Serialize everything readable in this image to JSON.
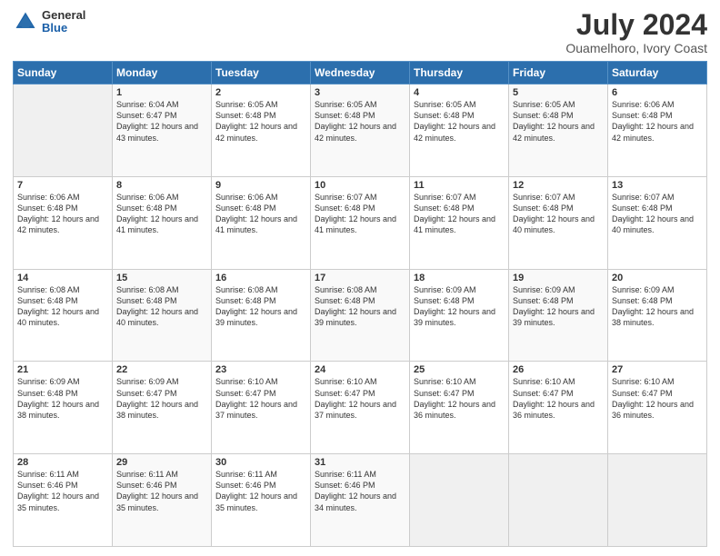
{
  "header": {
    "logo_general": "General",
    "logo_blue": "Blue",
    "title": "July 2024",
    "subtitle": "Ouamelhoro, Ivory Coast"
  },
  "days_of_week": [
    "Sunday",
    "Monday",
    "Tuesday",
    "Wednesday",
    "Thursday",
    "Friday",
    "Saturday"
  ],
  "weeks": [
    [
      {
        "day": "",
        "sunrise": "",
        "sunset": "",
        "daylight": ""
      },
      {
        "day": "1",
        "sunrise": "Sunrise: 6:04 AM",
        "sunset": "Sunset: 6:47 PM",
        "daylight": "Daylight: 12 hours and 43 minutes."
      },
      {
        "day": "2",
        "sunrise": "Sunrise: 6:05 AM",
        "sunset": "Sunset: 6:48 PM",
        "daylight": "Daylight: 12 hours and 42 minutes."
      },
      {
        "day": "3",
        "sunrise": "Sunrise: 6:05 AM",
        "sunset": "Sunset: 6:48 PM",
        "daylight": "Daylight: 12 hours and 42 minutes."
      },
      {
        "day": "4",
        "sunrise": "Sunrise: 6:05 AM",
        "sunset": "Sunset: 6:48 PM",
        "daylight": "Daylight: 12 hours and 42 minutes."
      },
      {
        "day": "5",
        "sunrise": "Sunrise: 6:05 AM",
        "sunset": "Sunset: 6:48 PM",
        "daylight": "Daylight: 12 hours and 42 minutes."
      },
      {
        "day": "6",
        "sunrise": "Sunrise: 6:06 AM",
        "sunset": "Sunset: 6:48 PM",
        "daylight": "Daylight: 12 hours and 42 minutes."
      }
    ],
    [
      {
        "day": "7",
        "sunrise": "Sunrise: 6:06 AM",
        "sunset": "Sunset: 6:48 PM",
        "daylight": "Daylight: 12 hours and 42 minutes."
      },
      {
        "day": "8",
        "sunrise": "Sunrise: 6:06 AM",
        "sunset": "Sunset: 6:48 PM",
        "daylight": "Daylight: 12 hours and 41 minutes."
      },
      {
        "day": "9",
        "sunrise": "Sunrise: 6:06 AM",
        "sunset": "Sunset: 6:48 PM",
        "daylight": "Daylight: 12 hours and 41 minutes."
      },
      {
        "day": "10",
        "sunrise": "Sunrise: 6:07 AM",
        "sunset": "Sunset: 6:48 PM",
        "daylight": "Daylight: 12 hours and 41 minutes."
      },
      {
        "day": "11",
        "sunrise": "Sunrise: 6:07 AM",
        "sunset": "Sunset: 6:48 PM",
        "daylight": "Daylight: 12 hours and 41 minutes."
      },
      {
        "day": "12",
        "sunrise": "Sunrise: 6:07 AM",
        "sunset": "Sunset: 6:48 PM",
        "daylight": "Daylight: 12 hours and 40 minutes."
      },
      {
        "day": "13",
        "sunrise": "Sunrise: 6:07 AM",
        "sunset": "Sunset: 6:48 PM",
        "daylight": "Daylight: 12 hours and 40 minutes."
      }
    ],
    [
      {
        "day": "14",
        "sunrise": "Sunrise: 6:08 AM",
        "sunset": "Sunset: 6:48 PM",
        "daylight": "Daylight: 12 hours and 40 minutes."
      },
      {
        "day": "15",
        "sunrise": "Sunrise: 6:08 AM",
        "sunset": "Sunset: 6:48 PM",
        "daylight": "Daylight: 12 hours and 40 minutes."
      },
      {
        "day": "16",
        "sunrise": "Sunrise: 6:08 AM",
        "sunset": "Sunset: 6:48 PM",
        "daylight": "Daylight: 12 hours and 39 minutes."
      },
      {
        "day": "17",
        "sunrise": "Sunrise: 6:08 AM",
        "sunset": "Sunset: 6:48 PM",
        "daylight": "Daylight: 12 hours and 39 minutes."
      },
      {
        "day": "18",
        "sunrise": "Sunrise: 6:09 AM",
        "sunset": "Sunset: 6:48 PM",
        "daylight": "Daylight: 12 hours and 39 minutes."
      },
      {
        "day": "19",
        "sunrise": "Sunrise: 6:09 AM",
        "sunset": "Sunset: 6:48 PM",
        "daylight": "Daylight: 12 hours and 39 minutes."
      },
      {
        "day": "20",
        "sunrise": "Sunrise: 6:09 AM",
        "sunset": "Sunset: 6:48 PM",
        "daylight": "Daylight: 12 hours and 38 minutes."
      }
    ],
    [
      {
        "day": "21",
        "sunrise": "Sunrise: 6:09 AM",
        "sunset": "Sunset: 6:48 PM",
        "daylight": "Daylight: 12 hours and 38 minutes."
      },
      {
        "day": "22",
        "sunrise": "Sunrise: 6:09 AM",
        "sunset": "Sunset: 6:47 PM",
        "daylight": "Daylight: 12 hours and 38 minutes."
      },
      {
        "day": "23",
        "sunrise": "Sunrise: 6:10 AM",
        "sunset": "Sunset: 6:47 PM",
        "daylight": "Daylight: 12 hours and 37 minutes."
      },
      {
        "day": "24",
        "sunrise": "Sunrise: 6:10 AM",
        "sunset": "Sunset: 6:47 PM",
        "daylight": "Daylight: 12 hours and 37 minutes."
      },
      {
        "day": "25",
        "sunrise": "Sunrise: 6:10 AM",
        "sunset": "Sunset: 6:47 PM",
        "daylight": "Daylight: 12 hours and 36 minutes."
      },
      {
        "day": "26",
        "sunrise": "Sunrise: 6:10 AM",
        "sunset": "Sunset: 6:47 PM",
        "daylight": "Daylight: 12 hours and 36 minutes."
      },
      {
        "day": "27",
        "sunrise": "Sunrise: 6:10 AM",
        "sunset": "Sunset: 6:47 PM",
        "daylight": "Daylight: 12 hours and 36 minutes."
      }
    ],
    [
      {
        "day": "28",
        "sunrise": "Sunrise: 6:11 AM",
        "sunset": "Sunset: 6:46 PM",
        "daylight": "Daylight: 12 hours and 35 minutes."
      },
      {
        "day": "29",
        "sunrise": "Sunrise: 6:11 AM",
        "sunset": "Sunset: 6:46 PM",
        "daylight": "Daylight: 12 hours and 35 minutes."
      },
      {
        "day": "30",
        "sunrise": "Sunrise: 6:11 AM",
        "sunset": "Sunset: 6:46 PM",
        "daylight": "Daylight: 12 hours and 35 minutes."
      },
      {
        "day": "31",
        "sunrise": "Sunrise: 6:11 AM",
        "sunset": "Sunset: 6:46 PM",
        "daylight": "Daylight: 12 hours and 34 minutes."
      },
      {
        "day": "",
        "sunrise": "",
        "sunset": "",
        "daylight": ""
      },
      {
        "day": "",
        "sunrise": "",
        "sunset": "",
        "daylight": ""
      },
      {
        "day": "",
        "sunrise": "",
        "sunset": "",
        "daylight": ""
      }
    ]
  ]
}
